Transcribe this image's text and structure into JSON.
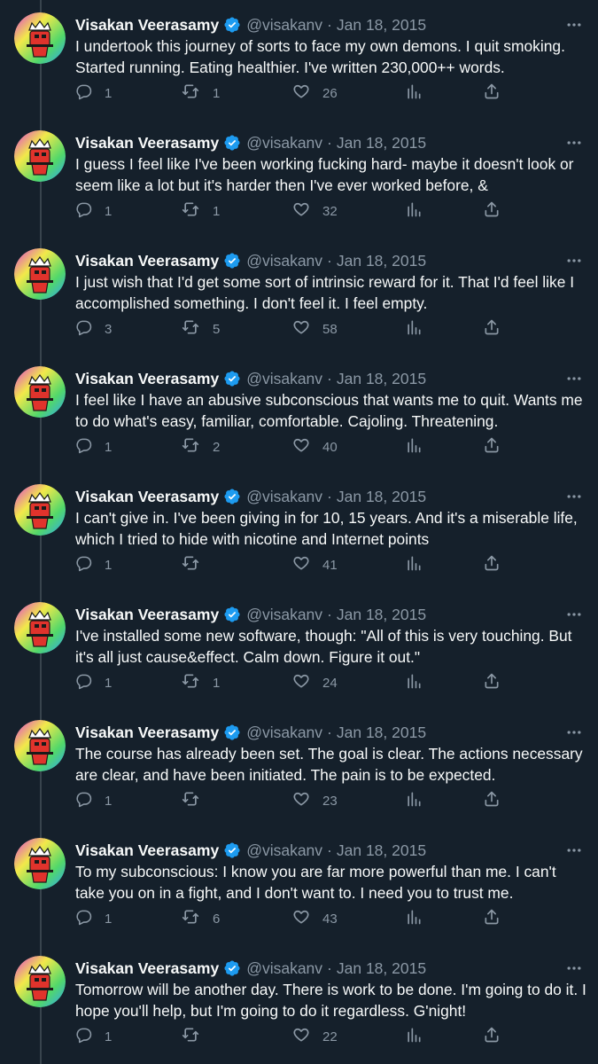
{
  "colors": {
    "background": "#15202b",
    "text_primary": "#f7f9f9",
    "text_secondary": "#8b98a5",
    "verified_badge": "#1d9bf0",
    "thread_line": "#38444d"
  },
  "icons": {
    "verified": "verified-badge-icon",
    "more": "more-icon",
    "reply": "reply-icon",
    "retweet": "retweet-icon",
    "like": "like-icon",
    "views": "views-icon",
    "share": "share-icon"
  },
  "tweets": [
    {
      "name": "Visakan Veerasamy",
      "handle": "@visakanv",
      "separator": "·",
      "date": "Jan 18, 2015",
      "text": "I undertook this journey of sorts to face my own demons. I quit smoking. Started running. Eating healthier. I've written 230,000++ words.",
      "replies": "1",
      "retweets": "1",
      "likes": "26"
    },
    {
      "name": "Visakan Veerasamy",
      "handle": "@visakanv",
      "separator": "·",
      "date": "Jan 18, 2015",
      "text": "I guess I feel like I've been working fucking hard- maybe it doesn't look or seem like a lot but it's harder then I've ever worked before, &",
      "replies": "1",
      "retweets": "1",
      "likes": "32"
    },
    {
      "name": "Visakan Veerasamy",
      "handle": "@visakanv",
      "separator": "·",
      "date": "Jan 18, 2015",
      "text": "I just wish that I'd get some sort of intrinsic reward for it. That I'd feel like I accomplished something. I don't feel it. I feel empty.",
      "replies": "3",
      "retweets": "5",
      "likes": "58"
    },
    {
      "name": "Visakan Veerasamy",
      "handle": "@visakanv",
      "separator": "·",
      "date": "Jan 18, 2015",
      "text": "I feel like I have an abusive subconscious that wants me to quit. Wants me to do what's easy, familiar, comfortable. Cajoling. Threatening.",
      "replies": "1",
      "retweets": "2",
      "likes": "40"
    },
    {
      "name": "Visakan Veerasamy",
      "handle": "@visakanv",
      "separator": "·",
      "date": "Jan 18, 2015",
      "text": "I can't give in. I've been giving in for 10, 15 years. And it's a miserable life, which I tried to hide with nicotine and Internet points",
      "replies": "1",
      "retweets": "",
      "likes": "41"
    },
    {
      "name": "Visakan Veerasamy",
      "handle": "@visakanv",
      "separator": "·",
      "date": "Jan 18, 2015",
      "text": "I've installed some new software, though:  \"All of this is very touching. But it's all just cause&effect. Calm down. Figure it out.\"",
      "replies": "1",
      "retweets": "1",
      "likes": "24"
    },
    {
      "name": "Visakan Veerasamy",
      "handle": "@visakanv",
      "separator": "·",
      "date": "Jan 18, 2015",
      "text": "The course has already been set. The goal is clear. The actions necessary are clear, and have been initiated. The pain is to be expected.",
      "replies": "1",
      "retweets": "",
      "likes": "23"
    },
    {
      "name": "Visakan Veerasamy",
      "handle": "@visakanv",
      "separator": "·",
      "date": "Jan 18, 2015",
      "text": "To my subconscious: I know you are far more powerful than me. I can't take you on in a fight, and I don't want to. I need you to trust me.",
      "replies": "1",
      "retweets": "6",
      "likes": "43"
    },
    {
      "name": "Visakan Veerasamy",
      "handle": "@visakanv",
      "separator": "·",
      "date": "Jan 18, 2015",
      "text": "Tomorrow will be another day. There is work to be done. I'm going to do it. I hope you'll help, but I'm going to do it regardless. G'night!",
      "replies": "1",
      "retweets": "",
      "likes": "22"
    }
  ]
}
